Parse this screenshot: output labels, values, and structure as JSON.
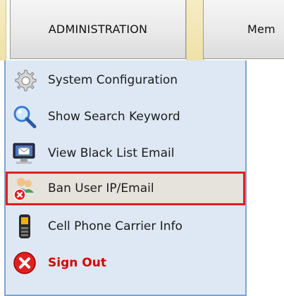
{
  "tabs": {
    "administration": "ADMINISTRATION",
    "members": "Mem"
  },
  "menu": {
    "items": [
      {
        "label": "System Configuration",
        "icon": "gear-icon"
      },
      {
        "label": "Show Search Keyword",
        "icon": "magnifier-icon"
      },
      {
        "label": "View Black List Email",
        "icon": "monitor-email-icon"
      },
      {
        "label": "Ban User IP/Email",
        "icon": "ban-users-icon",
        "highlighted": true
      },
      {
        "label": "Cell Phone Carrier Info",
        "icon": "cell-phone-icon"
      },
      {
        "label": "Sign Out",
        "icon": "sign-out-icon"
      }
    ]
  },
  "colors": {
    "menu_bg": "#dde8f4",
    "menu_border": "#7fa3cf",
    "highlight_border": "#e01e1e",
    "signout_text": "#d40000"
  }
}
